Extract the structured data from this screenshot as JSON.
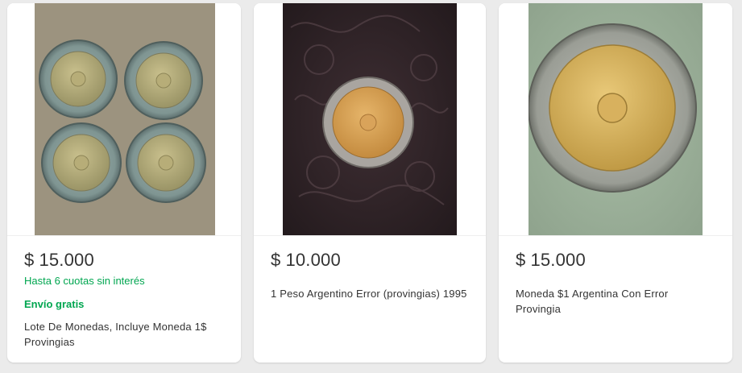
{
  "listings": [
    {
      "currency": "$",
      "price": "15.000",
      "installments": "Hasta 6 cuotas sin interés",
      "shipping": "Envío gratis",
      "title_line1": "Lote De Monedas, Incluye Moneda 1$",
      "title_line2": "Provingias",
      "image": "four-bimetallic-coins-photo"
    },
    {
      "currency": "$",
      "price": "10.000",
      "title_line1": "1 Peso Argentino Error (provingias) 1995",
      "title_line2": "",
      "image": "single-coin-on-leather-photo"
    },
    {
      "currency": "$",
      "price": "15.000",
      "title_line1": "Moneda $1 Argentina Con Error",
      "title_line2": "Provingia",
      "image": "closeup-coin-photo"
    }
  ],
  "colors": {
    "price_text": "#333333",
    "installments_green": "#00a650",
    "page_background": "#ebebeb",
    "card_background": "#ffffff"
  }
}
